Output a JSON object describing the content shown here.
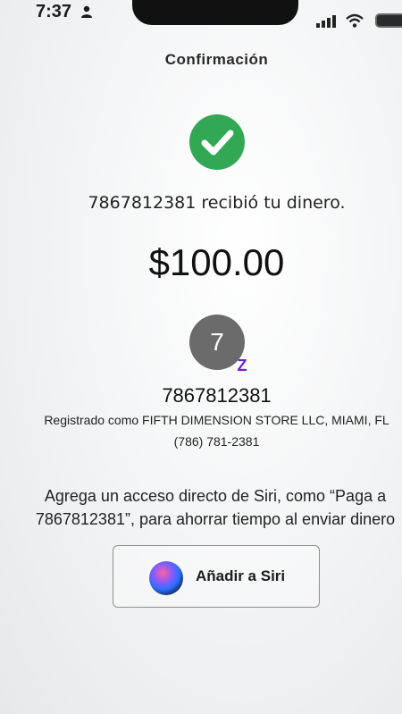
{
  "status_bar": {
    "time": "7:37",
    "icons": [
      "person-icon",
      "signal-icon",
      "wifi-icon",
      "battery-icon"
    ]
  },
  "nav": {
    "title": "Confirmación"
  },
  "confirmation": {
    "icon": "check-icon",
    "accent_color": "#33a854",
    "message": "7867812381 recibió tu dinero.",
    "amount": "$100.00"
  },
  "recipient": {
    "avatar_initial": "7",
    "badge": "Z",
    "badge_color": "#6d1ed4",
    "name": "7867812381",
    "registered": "Registrado como FIFTH DIMENSION STORE LLC, MIAMI, FL",
    "phone": "(786) 781-2381"
  },
  "siri": {
    "description_line1": "Agrega un acceso directo de Siri, como “Paga a",
    "description_line2": "7867812381”, para ahorrar tiempo al enviar dinero",
    "button_label": "Añadir a Siri",
    "icon": "siri-icon"
  }
}
